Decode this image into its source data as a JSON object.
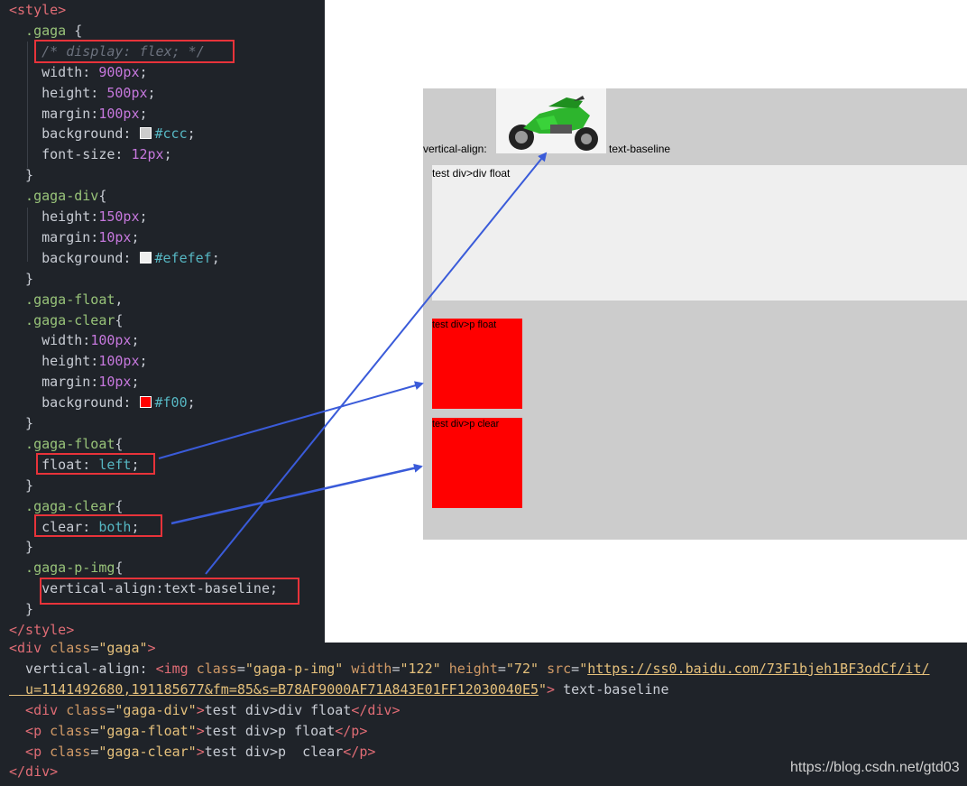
{
  "editor": {
    "lines": [
      [
        [
          "tag",
          "<style>"
        ]
      ],
      [
        [
          "sel",
          "  .gaga "
        ],
        [
          "punc",
          "{"
        ]
      ],
      [
        [
          "cmt",
          "    /* display: flex; */"
        ]
      ],
      [
        [
          "prop",
          "    width: "
        ],
        [
          "num",
          "900px"
        ],
        [
          "punc",
          ";"
        ]
      ],
      [
        [
          "prop",
          "    height: "
        ],
        [
          "num",
          "500px"
        ],
        [
          "punc",
          ";"
        ]
      ],
      [
        [
          "prop",
          "    margin:"
        ],
        [
          "num",
          "100px"
        ],
        [
          "punc",
          ";"
        ]
      ],
      [
        [
          "prop",
          "    background: "
        ],
        [
          "swatch",
          "#cccccc"
        ],
        [
          "kw",
          "#ccc"
        ],
        [
          "punc",
          ";"
        ]
      ],
      [
        [
          "prop",
          "    font-size: "
        ],
        [
          "num",
          "12px"
        ],
        [
          "punc",
          ";"
        ]
      ],
      [
        [
          "punc",
          "  }"
        ]
      ],
      [
        [
          "sel",
          "  .gaga-div"
        ],
        [
          "punc",
          "{"
        ]
      ],
      [
        [
          "prop",
          "    height:"
        ],
        [
          "num",
          "150px"
        ],
        [
          "punc",
          ";"
        ]
      ],
      [
        [
          "prop",
          "    margin:"
        ],
        [
          "num",
          "10px"
        ],
        [
          "punc",
          ";"
        ]
      ],
      [
        [
          "prop",
          "    background: "
        ],
        [
          "swatch",
          "#efefef"
        ],
        [
          "kw",
          "#efefef"
        ],
        [
          "punc",
          ";"
        ]
      ],
      [
        [
          "punc",
          "  }"
        ]
      ],
      [
        [
          "sel",
          "  .gaga-float"
        ],
        [
          "punc",
          ","
        ]
      ],
      [
        [
          "sel",
          "  .gaga-clear"
        ],
        [
          "punc",
          "{"
        ]
      ],
      [
        [
          "prop",
          "    width:"
        ],
        [
          "num",
          "100px"
        ],
        [
          "punc",
          ";"
        ]
      ],
      [
        [
          "prop",
          "    height:"
        ],
        [
          "num",
          "100px"
        ],
        [
          "punc",
          ";"
        ]
      ],
      [
        [
          "prop",
          "    margin:"
        ],
        [
          "num",
          "10px"
        ],
        [
          "punc",
          ";"
        ]
      ],
      [
        [
          "prop",
          "    background: "
        ],
        [
          "swatch",
          "#ff0000"
        ],
        [
          "kw",
          "#f00"
        ],
        [
          "punc",
          ";"
        ]
      ],
      [
        [
          "punc",
          "  }"
        ]
      ],
      [
        [
          "sel",
          "  .gaga-float"
        ],
        [
          "punc",
          "{"
        ]
      ],
      [
        [
          "prop",
          "    float: "
        ],
        [
          "kw",
          "left"
        ],
        [
          "punc",
          ";"
        ]
      ],
      [
        [
          "punc",
          "  }"
        ]
      ],
      [
        [
          "sel",
          "  .gaga-clear"
        ],
        [
          "punc",
          "{"
        ]
      ],
      [
        [
          "prop",
          "    clear: "
        ],
        [
          "kw",
          "both"
        ],
        [
          "punc",
          ";"
        ]
      ],
      [
        [
          "punc",
          "  }"
        ]
      ],
      [
        [
          "sel",
          "  .gaga-p-img"
        ],
        [
          "punc",
          "{"
        ]
      ],
      [
        [
          "prop",
          "    vertical-align:text-baseline;"
        ]
      ],
      [
        [
          "punc",
          "  }"
        ]
      ],
      [
        [
          "tag",
          "</style>"
        ]
      ]
    ],
    "html_lines": [
      [
        [
          "tag",
          "<div "
        ],
        [
          "attr",
          "class"
        ],
        [
          "punc",
          "="
        ],
        [
          "str",
          "\"gaga\""
        ],
        [
          "tag",
          ">"
        ]
      ],
      [
        [
          "punc",
          "  vertical-align: "
        ],
        [
          "tag",
          "<img "
        ],
        [
          "attr",
          "class"
        ],
        [
          "punc",
          "="
        ],
        [
          "str",
          "\"gaga-p-img\" "
        ],
        [
          "attr",
          "width"
        ],
        [
          "punc",
          "="
        ],
        [
          "str",
          "\"122\" "
        ],
        [
          "attr",
          "height"
        ],
        [
          "punc",
          "="
        ],
        [
          "str",
          "\"72\" "
        ],
        [
          "attr",
          "src"
        ],
        [
          "punc",
          "="
        ],
        [
          "str",
          "\""
        ],
        [
          "url",
          "https://ss0.baidu.com/73F1bjeh1BF3odCf/it/"
        ]
      ],
      [
        [
          "url",
          "  u=1141492680,191185677&fm=85&s=B78AF9000AF71A843E01FF12030040E5"
        ],
        [
          "str",
          "\""
        ],
        [
          "tag",
          "> "
        ],
        [
          "punc",
          "text-baseline"
        ]
      ],
      [
        [
          "tag",
          "  <div "
        ],
        [
          "attr",
          "class"
        ],
        [
          "punc",
          "="
        ],
        [
          "str",
          "\"gaga-div\""
        ],
        [
          "tag",
          ">"
        ],
        [
          "punc",
          "test div>div float"
        ],
        [
          "tag",
          "</div>"
        ]
      ],
      [
        [
          "tag",
          "  <p "
        ],
        [
          "attr",
          "class"
        ],
        [
          "punc",
          "="
        ],
        [
          "str",
          "\"gaga-float\""
        ],
        [
          "tag",
          ">"
        ],
        [
          "punc",
          "test div>p float"
        ],
        [
          "tag",
          "</p>"
        ]
      ],
      [
        [
          "tag",
          "  <p "
        ],
        [
          "attr",
          "class"
        ],
        [
          "punc",
          "="
        ],
        [
          "str",
          "\"gaga-clear\""
        ],
        [
          "tag",
          ">"
        ],
        [
          "punc",
          "test div>p  clear"
        ],
        [
          "tag",
          "</p>"
        ]
      ],
      [
        [
          "tag",
          "</div>"
        ]
      ]
    ]
  },
  "preview": {
    "vertical_align_label": "vertical-align:",
    "text_baseline_label": "text-baseline",
    "div_float_text": "test div>div float",
    "p_float_text": "test div>p float",
    "p_clear_text": "test div>p clear"
  },
  "colors": {
    "annotation_red": "#e8333a",
    "arrow_blue": "#3a5bd9"
  },
  "watermark": "https://blog.csdn.net/gtd03"
}
